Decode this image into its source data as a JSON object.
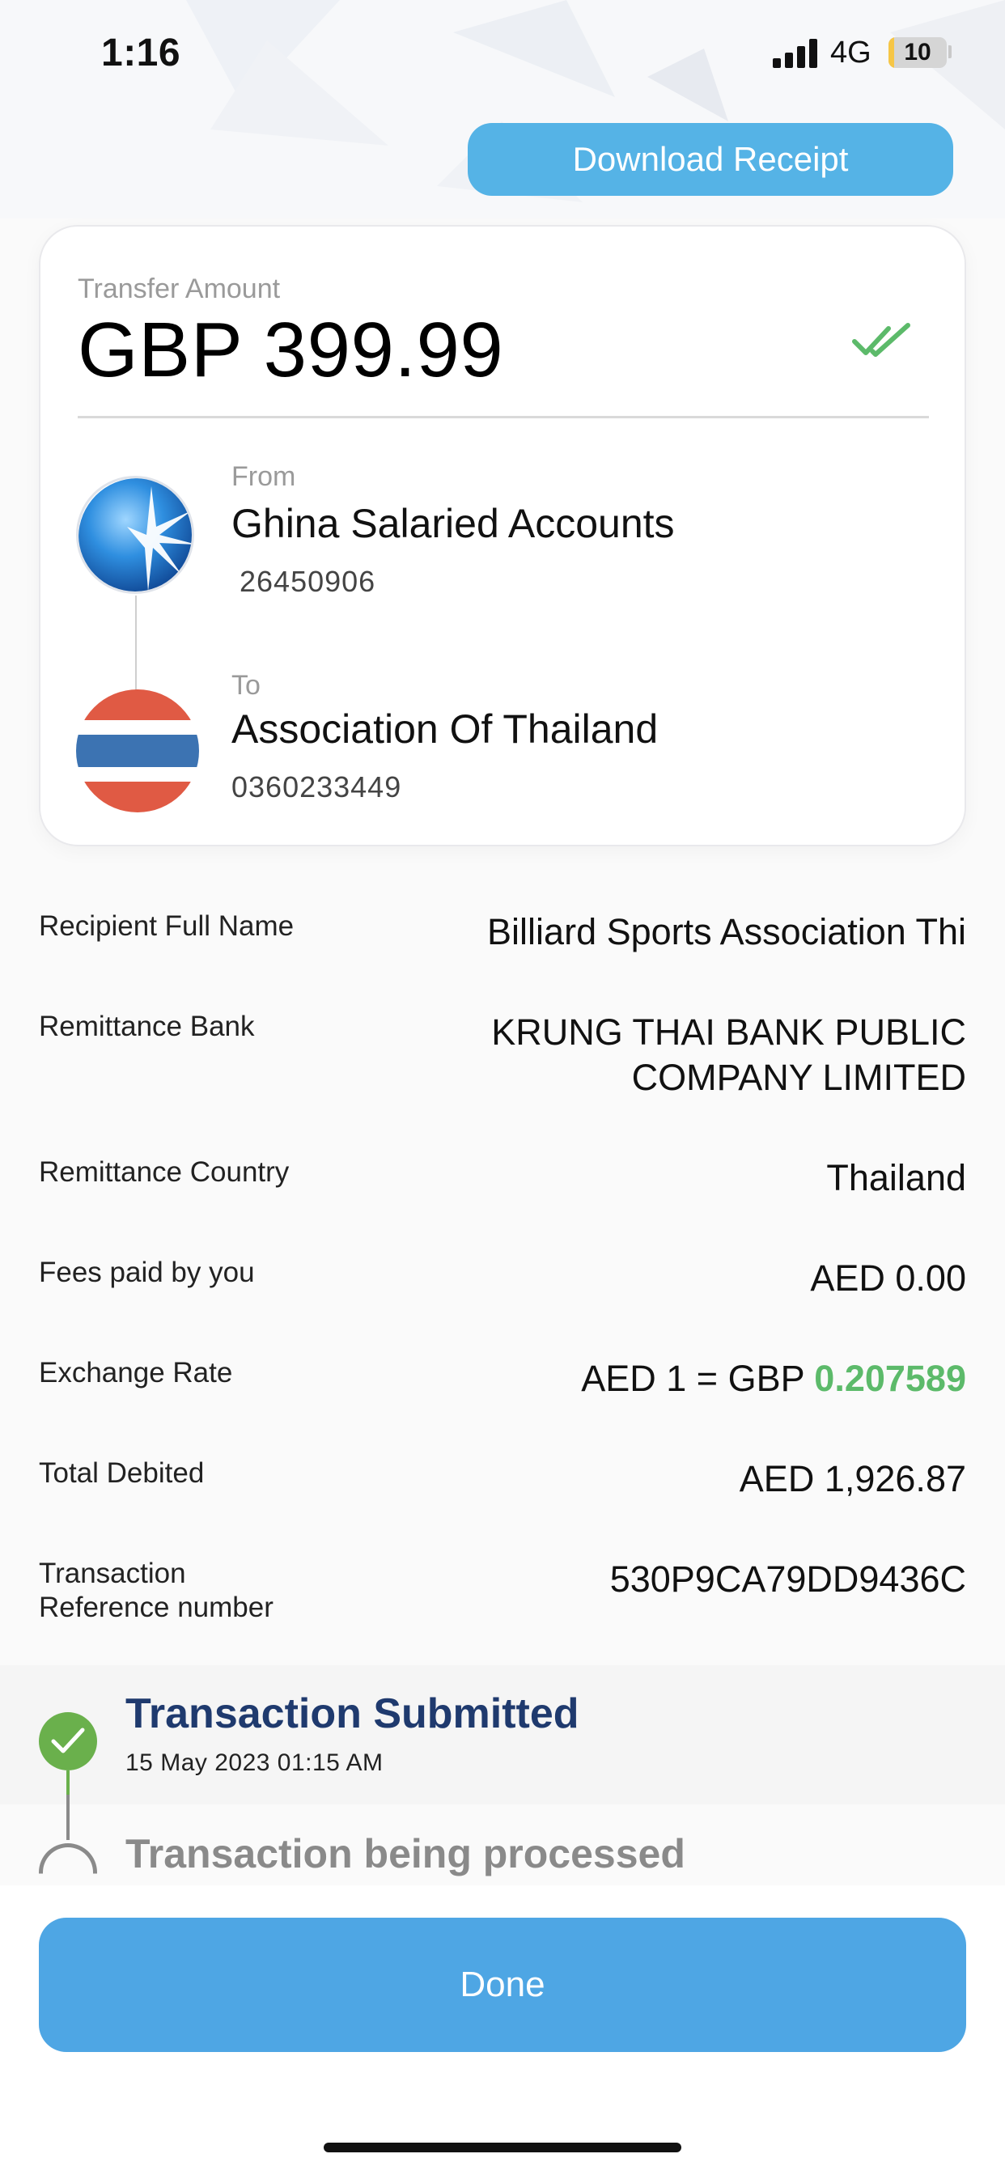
{
  "status_bar": {
    "time": "1:16",
    "network": "4G",
    "battery": "10",
    "battery_level": 0.1
  },
  "header": {
    "download_label": "Download Receipt"
  },
  "transfer": {
    "amount_label": "Transfer Amount",
    "amount": "GBP 399.99",
    "from": {
      "label": "From",
      "name": "Ghina Salaried Accounts",
      "account": "26450906"
    },
    "to": {
      "label": "To",
      "name": "Association Of Thailand",
      "account": "0360233449"
    }
  },
  "details": {
    "recipient_name": {
      "label": "Recipient Full Name",
      "value": "Billiard Sports Association Thi"
    },
    "remittance_bank": {
      "label": "Remittance Bank",
      "value_line1": "KRUNG THAI BANK PUBLIC",
      "value_line2": "COMPANY LIMITED"
    },
    "remittance_country": {
      "label": "Remittance Country",
      "value": "Thailand"
    },
    "fees": {
      "label": "Fees paid by you",
      "value": "AED 0.00"
    },
    "exchange_rate": {
      "label": "Exchange Rate",
      "value_prefix": "AED 1 = GBP ",
      "value_rate": "0.207589"
    },
    "total_debited": {
      "label": "Total Debited",
      "value": "AED 1,926.87"
    },
    "reference": {
      "label_line1": "Transaction",
      "label_line2": "Reference number",
      "value": "530P9CA79DD9436C"
    }
  },
  "timeline": {
    "step1_title": "Transaction Submitted",
    "step1_date": "15 May 2023 01:15 AM",
    "step2_title": "Transaction being processed"
  },
  "footer": {
    "done_label": "Done"
  },
  "colors": {
    "primary_blue": "#4ea6e4",
    "success_green": "#6ab04c",
    "rate_green": "#5cba6a",
    "heading_navy": "#1f3a6e"
  }
}
